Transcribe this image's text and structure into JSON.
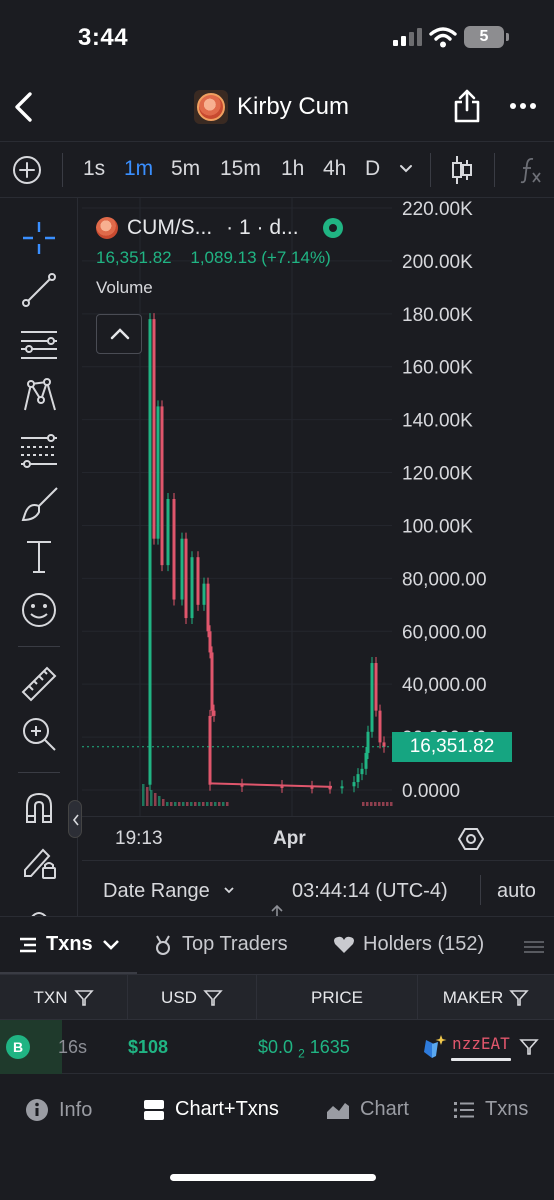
{
  "status_bar": {
    "time": "3:44",
    "battery": "5"
  },
  "header": {
    "title": "Kirby Cum"
  },
  "timeframes": {
    "items": [
      "1s",
      "1m",
      "5m",
      "15m",
      "1h",
      "4h",
      "D"
    ],
    "active": "1m"
  },
  "legend": {
    "symbol": "CUM/S...",
    "interval": "· 1 · d...",
    "price": "16,351.82",
    "change": "1,089.13 (+7.14%)",
    "volume_label": "Volume"
  },
  "colors": {
    "up": "#20b483",
    "down": "#e0566c",
    "accent": "#3a8fff",
    "price_tag": "#16a581"
  },
  "chart_data": {
    "type": "candlestick",
    "y_ticks": [
      "220.00K",
      "200.00K",
      "180.00K",
      "160.00K",
      "140.00K",
      "120.00K",
      "100.00K",
      "80,000.00",
      "60,000.00",
      "40,000.00",
      "20,000.00",
      "0.0000"
    ],
    "ylim": [
      0,
      220000
    ],
    "x_ticks": [
      "19:13",
      "Apr"
    ],
    "last_price": 16351.82,
    "last_price_label": "16,351.82",
    "series_trace": [
      {
        "i": 0,
        "v": 2000
      },
      {
        "i": 1,
        "v": 178000
      },
      {
        "i": 2,
        "v": 95000
      },
      {
        "i": 3,
        "v": 145000
      },
      {
        "i": 4,
        "v": 85000
      },
      {
        "i": 5,
        "v": 110000
      },
      {
        "i": 6,
        "v": 72000
      },
      {
        "i": 7,
        "v": 95000
      },
      {
        "i": 8,
        "v": 65000
      },
      {
        "i": 9,
        "v": 88000
      },
      {
        "i": 10,
        "v": 70000
      },
      {
        "i": 11,
        "v": 78000
      },
      {
        "i": 12,
        "v": 60000
      },
      {
        "i": 13,
        "v": 52000
      },
      {
        "i": 14,
        "v": 30000
      },
      {
        "i": 15,
        "v": 28000
      },
      {
        "i": 16,
        "v": 2000
      },
      {
        "i": 17,
        "v": 1500
      },
      {
        "i": 18,
        "v": 1200
      },
      {
        "i": 19,
        "v": 1000
      },
      {
        "i": 20,
        "v": 900
      },
      {
        "i": 21,
        "v": 1400
      },
      {
        "i": 22,
        "v": 3000
      },
      {
        "i": 23,
        "v": 6000
      },
      {
        "i": 24,
        "v": 8000
      },
      {
        "i": 25,
        "v": 14000
      },
      {
        "i": 26,
        "v": 22000
      },
      {
        "i": 27,
        "v": 48000
      },
      {
        "i": 28,
        "v": 30000
      },
      {
        "i": 29,
        "v": 18000
      },
      {
        "i": 30,
        "v": 16351.82
      }
    ]
  },
  "time_axis": {
    "labels": [
      "19:13",
      "Apr"
    ]
  },
  "range_bar": {
    "date_range": "Date Range",
    "clock": "03:44:14 (UTC-4)",
    "auto": "auto"
  },
  "tabs": [
    "Txns",
    "Top Traders",
    "Holders (152)"
  ],
  "table": {
    "headers": [
      "TXN",
      "USD",
      "PRICE",
      "MAKER"
    ],
    "rows": [
      {
        "type": "B",
        "age": "16s",
        "usd": "$108",
        "price_main": "$0.0",
        "price_sub": "2",
        "price_tail": "1635",
        "maker": "nzzEAT"
      }
    ]
  },
  "bottom_nav": [
    "Info",
    "Chart+Txns",
    "Chart",
    "Txns"
  ]
}
